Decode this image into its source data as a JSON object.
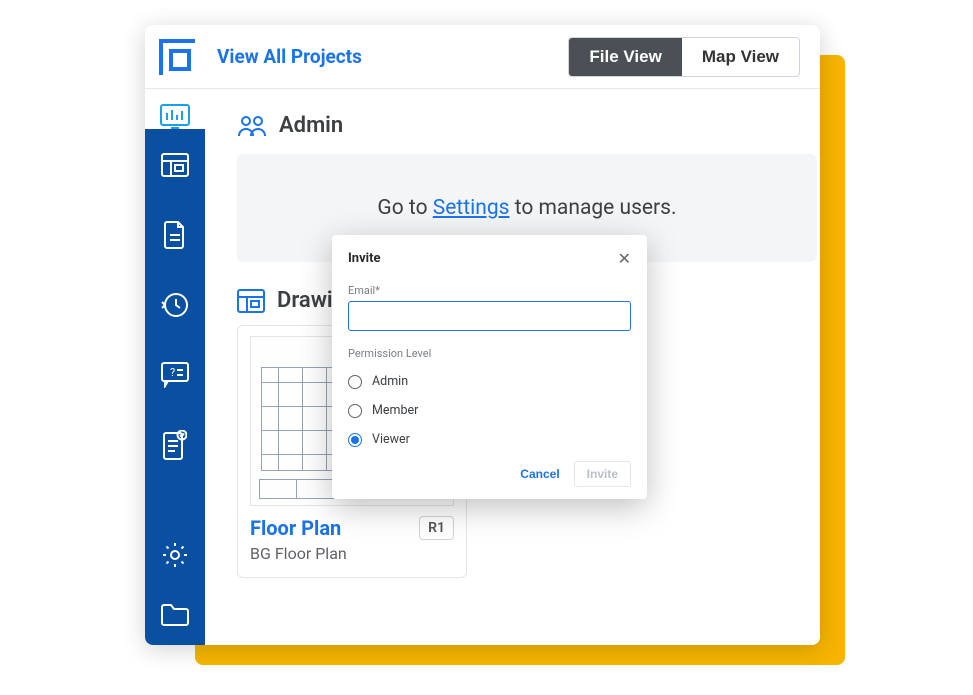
{
  "topbar": {
    "view_all_label": "View All Projects",
    "file_view_label": "File View",
    "map_view_label": "Map View"
  },
  "sections": {
    "admin": {
      "title": "Admin",
      "banner_prefix": "Go to ",
      "banner_link": "Settings",
      "banner_suffix": " to manage users."
    },
    "drawings": {
      "title": "Drawings",
      "cards": [
        {
          "title": "Floor Plan",
          "rev": "R1",
          "subtitle": "BG Floor Plan"
        }
      ]
    }
  },
  "modal": {
    "title": "Invite",
    "email_label": "Email*",
    "email_value": "",
    "perm_label": "Permission Level",
    "options": {
      "admin": "Admin",
      "member": "Member",
      "viewer": "Viewer"
    },
    "selected": "viewer",
    "cancel_label": "Cancel",
    "invite_label": "Invite"
  }
}
